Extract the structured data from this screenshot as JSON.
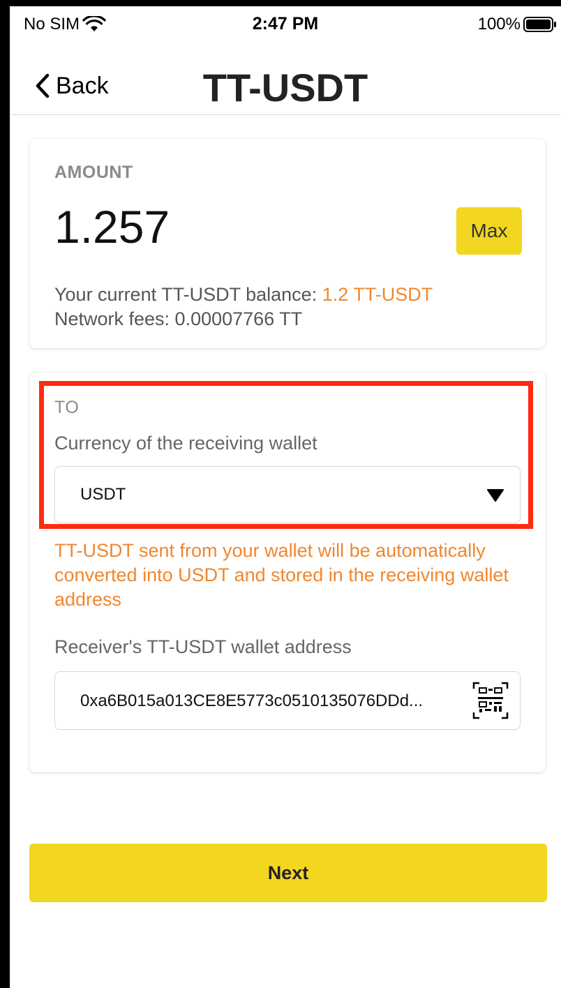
{
  "status_bar": {
    "carrier": "No SIM",
    "time": "2:47 PM",
    "battery": "100%",
    "wifi_icon": "wifi-icon",
    "battery_icon": "battery-full-icon"
  },
  "nav": {
    "back_label": "Back",
    "title": "TT-USDT"
  },
  "amount_card": {
    "label": "AMOUNT",
    "value": "1.257",
    "max_label": "Max",
    "balance_prefix": "Your current TT-USDT balance: ",
    "balance_value": "1.2 TT-USDT",
    "fees_text": "Network fees: 0.00007766 TT"
  },
  "to_card": {
    "label": "TO",
    "currency_label": "Currency of the receiving wallet",
    "currency_selected": "USDT",
    "conversion_note": "TT-USDT sent from your wallet will be automatically converted into USDT and stored in the receiving wallet address",
    "address_label": "Receiver's TT-USDT wallet address",
    "address_value": "0xa6B015a013CE8E5773c0510135076DDd..."
  },
  "next_label": "Next",
  "colors": {
    "accent_yellow": "#f2d620",
    "orange_text": "#f0872e",
    "highlight_red": "#ff2a10"
  }
}
